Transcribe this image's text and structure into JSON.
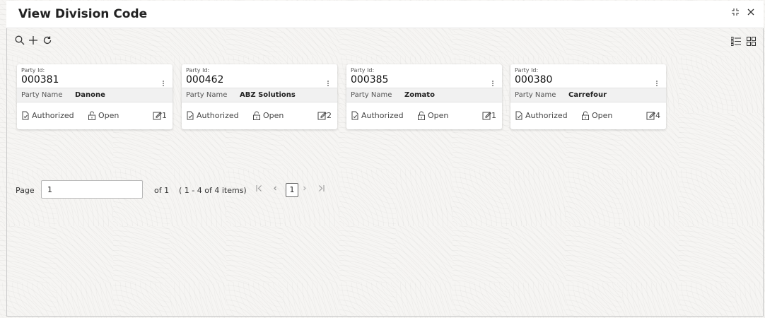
{
  "window": {
    "title": "View Division Code"
  },
  "toolbar": {
    "icons": [
      "search-icon",
      "add-icon",
      "refresh-icon"
    ],
    "view_icons": [
      "list-view-icon",
      "grid-view-icon"
    ]
  },
  "cards": [
    {
      "party_id_label": "Party Id:",
      "party_id": "000381",
      "party_name_label": "Party Name",
      "party_name": "Danone",
      "auth_status": "Authorized",
      "record_status": "Open",
      "modifications": "1"
    },
    {
      "party_id_label": "Party Id:",
      "party_id": "000462",
      "party_name_label": "Party Name",
      "party_name": "ABZ Solutions",
      "auth_status": "Authorized",
      "record_status": "Open",
      "modifications": "2"
    },
    {
      "party_id_label": "Party Id:",
      "party_id": "000385",
      "party_name_label": "Party Name",
      "party_name": "Zomato",
      "auth_status": "Authorized",
      "record_status": "Open",
      "modifications": "1"
    },
    {
      "party_id_label": "Party Id:",
      "party_id": "000380",
      "party_name_label": "Party Name",
      "party_name": "Carrefour",
      "auth_status": "Authorized",
      "record_status": "Open",
      "modifications": "4"
    }
  ],
  "pagination": {
    "page_label": "Page",
    "page_value": "1",
    "of_total": "of 1",
    "items_summary": "( 1 - 4 of 4 items)",
    "current_page": "1"
  }
}
